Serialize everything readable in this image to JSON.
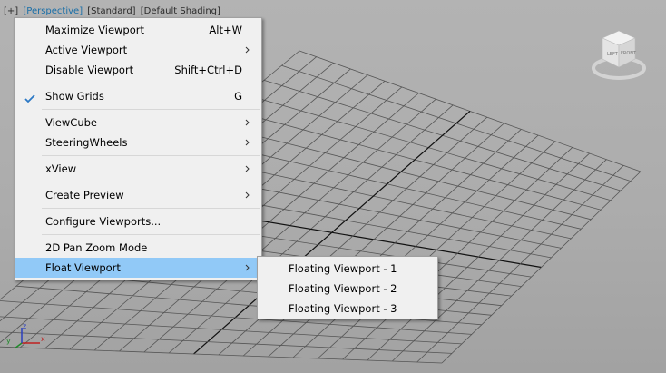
{
  "viewport": {
    "labels": [
      {
        "text": "[+]",
        "active": false
      },
      {
        "text": "[Perspective]",
        "active": true
      },
      {
        "text": "[Standard]",
        "active": false
      },
      {
        "text": "[Default Shading]",
        "active": false
      }
    ],
    "colors": {
      "background": "#acacac",
      "grid_line": "#555555",
      "grid_major": "#111111",
      "highlight": "#91c9f7"
    },
    "axis_labels": {
      "x": "x",
      "y": "y",
      "z": "z"
    },
    "viewcube_faces": {
      "left": "LEFT",
      "front": "FRONT"
    }
  },
  "context_menu": {
    "items": [
      {
        "label": "Maximize Viewport",
        "shortcut": "Alt+W",
        "submenu": false
      },
      {
        "label": "Active Viewport",
        "shortcut": "",
        "submenu": true
      },
      {
        "label": "Disable Viewport",
        "shortcut": "Shift+Ctrl+D",
        "submenu": false
      },
      {
        "label": "Show Grids",
        "shortcut": "G",
        "submenu": false,
        "checked": true
      },
      {
        "label": "ViewCube",
        "shortcut": "",
        "submenu": true
      },
      {
        "label": "SteeringWheels",
        "shortcut": "",
        "submenu": true
      },
      {
        "label": "xView",
        "shortcut": "",
        "submenu": true
      },
      {
        "label": "Create Preview",
        "shortcut": "",
        "submenu": true
      },
      {
        "label": "Configure Viewports...",
        "shortcut": "",
        "submenu": false
      },
      {
        "label": "2D Pan Zoom Mode",
        "shortcut": "",
        "submenu": false
      },
      {
        "label": "Float Viewport",
        "shortcut": "",
        "submenu": true,
        "highlighted": true
      }
    ]
  },
  "submenu": {
    "items": [
      {
        "label": "Floating Viewport - 1"
      },
      {
        "label": "Floating Viewport - 2"
      },
      {
        "label": "Floating Viewport - 3"
      }
    ]
  }
}
